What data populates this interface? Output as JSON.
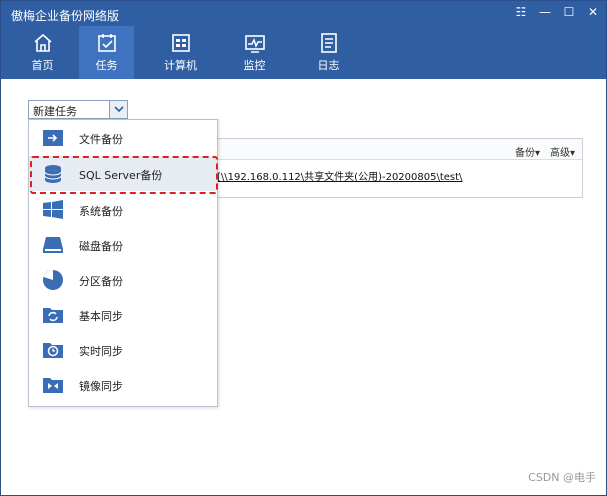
{
  "window": {
    "title": "傲梅企业备份网络版"
  },
  "window_controls": [
    "☷",
    "—",
    "☐",
    "✕"
  ],
  "nav": {
    "items": [
      {
        "label": "首页",
        "icon": "home-icon"
      },
      {
        "label": "任务",
        "icon": "task-icon",
        "active": true
      },
      {
        "label": "计算机",
        "icon": "computer-icon"
      },
      {
        "label": "监控",
        "icon": "monitor-icon"
      },
      {
        "label": "日志",
        "icon": "log-icon"
      }
    ]
  },
  "new_task_dropdown": {
    "selected": "新建任务"
  },
  "task_panel": {
    "header_buttons": [
      "备份▾",
      "高级▾"
    ],
    "task_name": "[\\\\192.168.0.112\\共享文件夹(公用)-20200805\\test\\"
  },
  "menu": {
    "items": [
      {
        "label": "文件备份",
        "icon": "file-backup-icon"
      },
      {
        "label": "SQL Server备份",
        "icon": "database-icon",
        "highlighted": true
      },
      {
        "label": "系统备份",
        "icon": "windows-icon"
      },
      {
        "label": "磁盘备份",
        "icon": "disk-icon"
      },
      {
        "label": "分区备份",
        "icon": "partition-icon"
      },
      {
        "label": "基本同步",
        "icon": "sync-icon"
      },
      {
        "label": "实时同步",
        "icon": "realtime-sync-icon"
      },
      {
        "label": "镜像同步",
        "icon": "mirror-sync-icon"
      }
    ]
  },
  "colors": {
    "header_bg": "#2f5ea3",
    "nav_active_bg": "#3f73bf",
    "icon_blue": "#3a6db5",
    "highlight_border": "#e02020"
  },
  "watermark": "CSDN @电手"
}
